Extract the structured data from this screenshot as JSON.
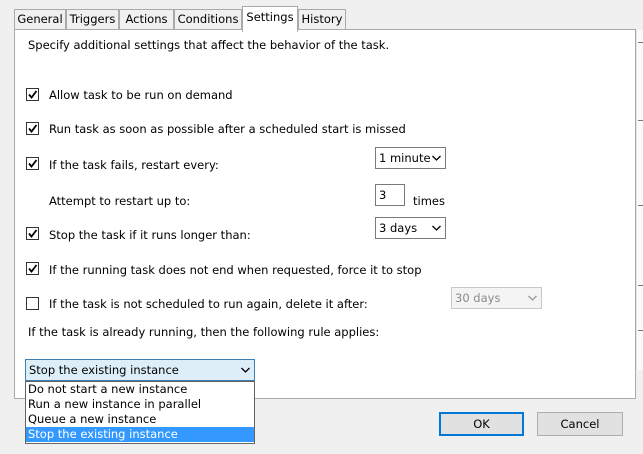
{
  "tabs": [
    {
      "label": "General"
    },
    {
      "label": "Triggers"
    },
    {
      "label": "Actions"
    },
    {
      "label": "Conditions"
    },
    {
      "label": "Settings",
      "active": true
    },
    {
      "label": "History"
    }
  ],
  "settings": {
    "description": "Specify additional settings that affect the behavior of the task.",
    "allow_on_demand": {
      "label": "Allow task to be run on demand",
      "checked": true
    },
    "run_missed": {
      "label": "Run task as soon as possible after a scheduled start is missed",
      "checked": true
    },
    "restart_on_fail": {
      "label": "If the task fails, restart every:",
      "checked": true,
      "interval": "1 minute"
    },
    "restart_attempts": {
      "label": "Attempt to restart up to:",
      "value": "3",
      "unit": "times"
    },
    "stop_longer": {
      "label": "Stop the task if it runs longer than:",
      "checked": true,
      "duration": "3 days"
    },
    "force_stop": {
      "label": "If the running task does not end when requested, force it to stop",
      "checked": true
    },
    "delete_after": {
      "label": "If the task is not scheduled to run again, delete it after:",
      "checked": false,
      "duration": "30 days"
    },
    "running_rule": {
      "label": "If the task is already running, then the following rule applies:",
      "selected": "Stop the existing instance",
      "options": [
        "Do not start a new instance",
        "Run a new instance in parallel",
        "Queue a new instance",
        "Stop the existing instance"
      ]
    }
  },
  "buttons": {
    "ok": "OK",
    "cancel": "Cancel"
  },
  "icons": {
    "checkmark": "check-icon",
    "combo_arrow": "chevron-down-icon"
  },
  "colors": {
    "selection": "#3399ff",
    "dropdown_head_bg": "#ddeef9",
    "default_button_border": "#0078d7"
  }
}
